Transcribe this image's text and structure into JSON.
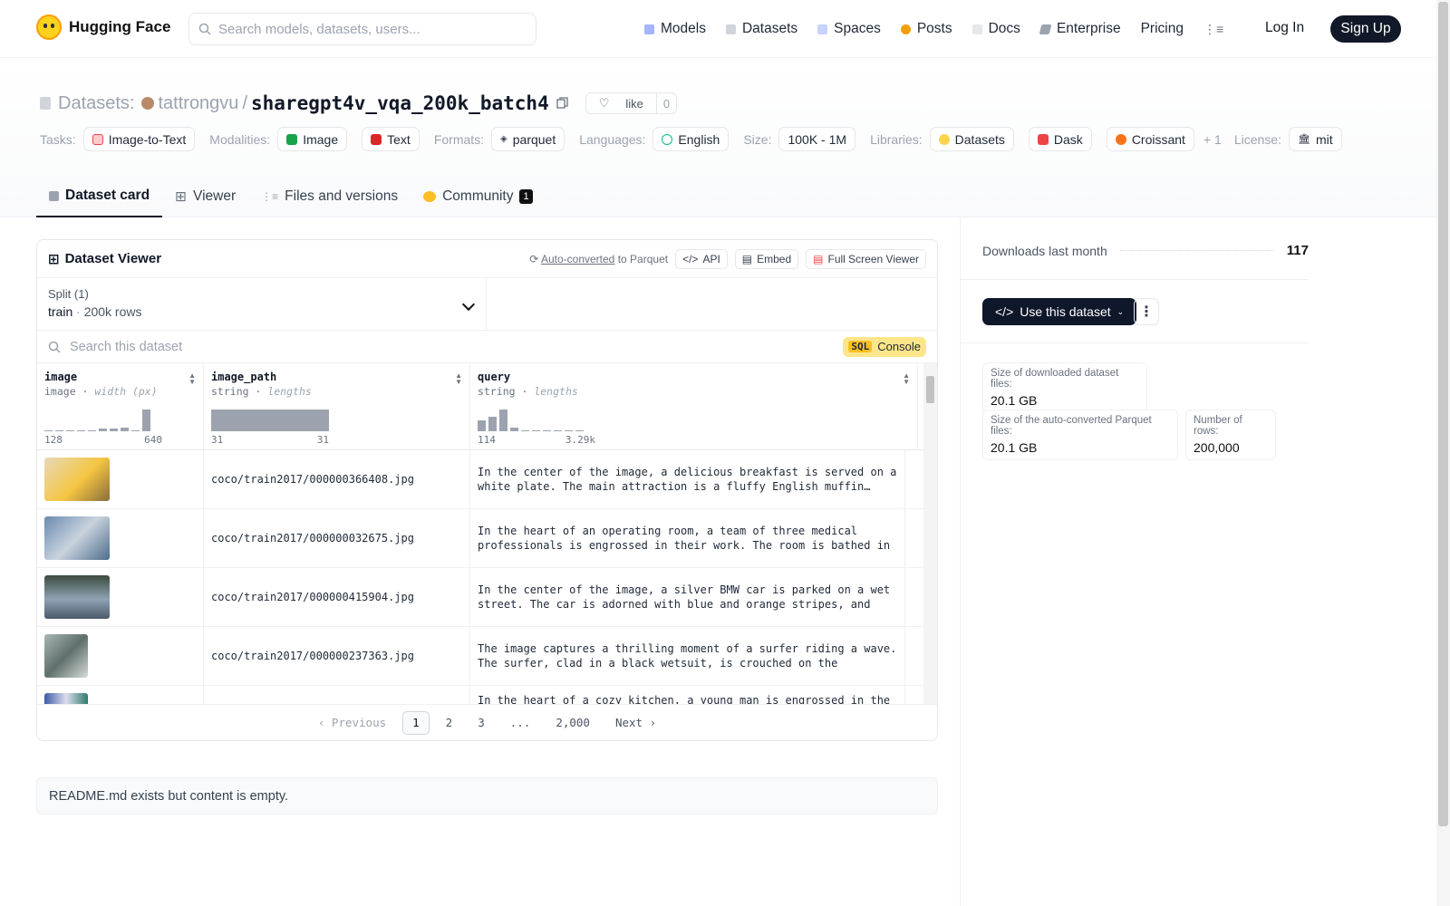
{
  "nav": {
    "brand": "Hugging Face",
    "search_placeholder": "Search models, datasets, users...",
    "links": [
      "Models",
      "Datasets",
      "Spaces",
      "Posts",
      "Docs",
      "Enterprise",
      "Pricing"
    ],
    "login": "Log In",
    "signup": "Sign Up"
  },
  "header": {
    "section": "Datasets:",
    "owner": "tattrongvu",
    "separator": "/",
    "name": "sharegpt4v_vqa_200k_batch4",
    "like_label": "like",
    "like_count": "0",
    "tags": {
      "tasks_label": "Tasks:",
      "task": "Image-to-Text",
      "modalities_label": "Modalities:",
      "modality_1": "Image",
      "modality_2": "Text",
      "formats_label": "Formats:",
      "format": "parquet",
      "languages_label": "Languages:",
      "language": "English",
      "size_label": "Size:",
      "size": "100K - 1M",
      "libraries_label": "Libraries:",
      "lib_1": "Datasets",
      "lib_2": "Dask",
      "lib_3": "Croissant",
      "lib_more": "+ 1",
      "license_label": "License:",
      "license": "mit"
    },
    "tabs": [
      "Dataset card",
      "Viewer",
      "Files and versions",
      "Community"
    ],
    "community_count": "1"
  },
  "viewer": {
    "title": "Dataset Viewer",
    "auto_converted": "Auto-converted",
    "to_parquet": "to Parquet",
    "api": "API",
    "embed": "Embed",
    "fullscreen": "Full Screen Viewer",
    "split_label": "Split (1)",
    "split_name": "train",
    "split_rows": "200k rows",
    "search_placeholder": "Search this dataset",
    "sql_badge": "SQL",
    "sql_label": "Console",
    "columns": [
      {
        "name": "image",
        "type": "image",
        "stat": "width (px)",
        "min": "128",
        "max": "640"
      },
      {
        "name": "image_path",
        "type": "string",
        "stat": "lengths",
        "min": "31",
        "max": "31"
      },
      {
        "name": "query",
        "type": "string",
        "stat": "lengths",
        "min": "114",
        "max": "3.29k"
      }
    ],
    "rows": [
      {
        "path": "coco/train2017/000000366408.jpg",
        "query": "In the center of the image, a delicious breakfast is served on a white plate. The main attraction is a fluffy English muffin…"
      },
      {
        "path": "coco/train2017/000000032675.jpg",
        "query": "In the heart of an operating room, a team of three medical professionals is engrossed in their work. The room is bathed in th…"
      },
      {
        "path": "coco/train2017/000000415904.jpg",
        "query": "In the center of the image, a silver BMW car is parked on a wet street. The car is adorned with blue and orange stripes, and the…"
      },
      {
        "path": "coco/train2017/000000237363.jpg",
        "query": "The image captures a thrilling moment of a surfer riding a wave. The surfer, clad in a black wetsuit, is crouched on the surfboard,…"
      },
      {
        "path": "",
        "query": "In the heart of a cozy kitchen, a young man is engrossed in the art"
      }
    ],
    "pager": {
      "prev": "Previous",
      "pages": [
        "1",
        "2",
        "3",
        "...",
        "2,000"
      ],
      "next": "Next"
    }
  },
  "readme": "README.md exists but content is empty.",
  "sidebar": {
    "downloads_label": "Downloads last month",
    "downloads_value": "117",
    "use_button": "Use this dataset",
    "dl_size_label": "Size of downloaded dataset files:",
    "dl_size_value": "20.1 GB",
    "parquet_size_label": "Size of the auto-converted Parquet files:",
    "parquet_size_value": "20.1 GB",
    "rows_label": "Number of rows:",
    "rows_value": "200,000"
  }
}
